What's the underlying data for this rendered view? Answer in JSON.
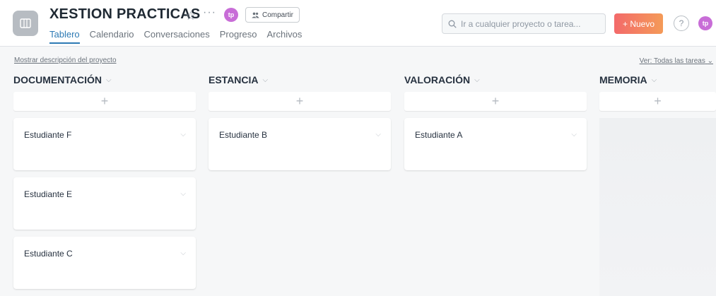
{
  "header": {
    "title": "XESTION PRACTICAS",
    "star_icon": "star-icon",
    "more_icon": "ellipsis-icon",
    "member_avatar": "tp",
    "share_label": "Compartir",
    "tabs": [
      {
        "label": "Tablero",
        "active": true
      },
      {
        "label": "Calendario",
        "active": false
      },
      {
        "label": "Conversaciones",
        "active": false
      },
      {
        "label": "Progreso",
        "active": false
      },
      {
        "label": "Archivos",
        "active": false
      }
    ],
    "search_placeholder": "Ir a cualquier proyecto o tarea...",
    "new_label": "+ Nuevo",
    "help_label": "?",
    "user_avatar": "tp",
    "accent_color": "#2d7ab4",
    "avatar_color": "#c86dd7"
  },
  "subheader": {
    "description_link": "Mostrar descripción del proyecto",
    "view_filter": "Ver: Todas las tareas"
  },
  "board": {
    "add_symbol": "+",
    "columns": [
      {
        "name": "DOCUMENTACIÓN",
        "cards": [
          "Estudiante F",
          "Estudiante E",
          "Estudiante C"
        ]
      },
      {
        "name": "ESTANCIA",
        "cards": [
          "Estudiante B"
        ]
      },
      {
        "name": "VALORACIÓN",
        "cards": [
          "Estudiante A"
        ]
      },
      {
        "name": "MEMORIA",
        "cards": []
      }
    ]
  }
}
